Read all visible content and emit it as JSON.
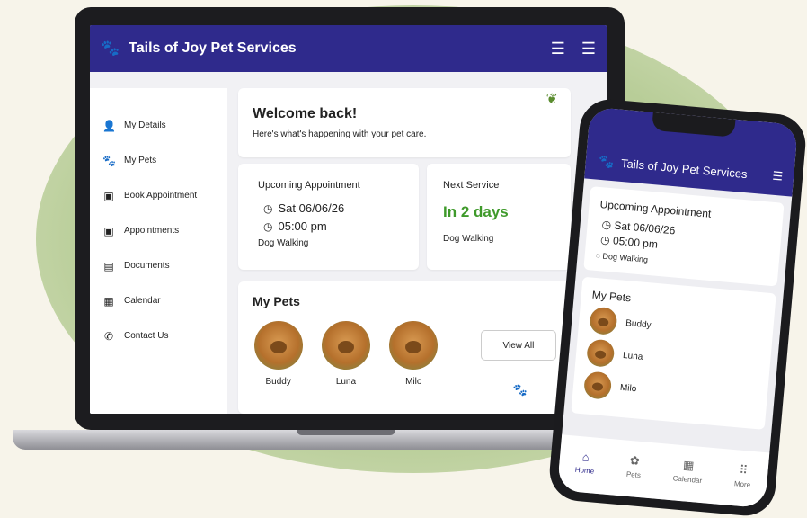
{
  "app": {
    "title": "Tails of Joy Pet Services"
  },
  "sidebar": {
    "items": [
      {
        "label": "My Details",
        "icon": "person-icon"
      },
      {
        "label": "My Pets",
        "icon": "paw-icon"
      },
      {
        "label": "Book Appointment",
        "icon": "calendar-plus-icon"
      },
      {
        "label": "Appointments",
        "icon": "calendar-check-icon"
      },
      {
        "label": "Documents",
        "icon": "document-icon"
      },
      {
        "label": "Calendar",
        "icon": "calendar-icon"
      },
      {
        "label": "Contact Us",
        "icon": "phone-icon"
      }
    ]
  },
  "welcome": {
    "title": "Welcome back!",
    "subtitle": "Here's what's happening with your pet care."
  },
  "upcoming": {
    "heading": "Upcoming Appointment",
    "date": "Sat 06/06/26",
    "time": "05:00 pm",
    "service": "Dog Walking"
  },
  "next_service": {
    "heading": "Next Service",
    "value": "In 2 days",
    "service": "Dog Walking"
  },
  "pets": {
    "heading": "My Pets",
    "list": [
      {
        "name": "Buddy"
      },
      {
        "name": "Luna"
      },
      {
        "name": "Milo"
      }
    ],
    "view_all": "View All"
  },
  "mobile": {
    "title": "Tails of Joy Pet Services",
    "upcoming_heading": "Upcoming Appointment",
    "date": "Sat 06/06/26",
    "time": "05:00 pm",
    "service": "Dog Walking",
    "pets_heading": "My Pets",
    "tabs": [
      {
        "label": "Home",
        "icon": "home-icon"
      },
      {
        "label": "Pets",
        "icon": "paw-icon"
      },
      {
        "label": "Calendar",
        "icon": "calendar-icon"
      },
      {
        "label": "More",
        "icon": "grid-icon"
      }
    ]
  },
  "colors": {
    "header": "#2f2a8c",
    "accent_green": "#3f9a2b",
    "background": "#f7f4ea"
  }
}
